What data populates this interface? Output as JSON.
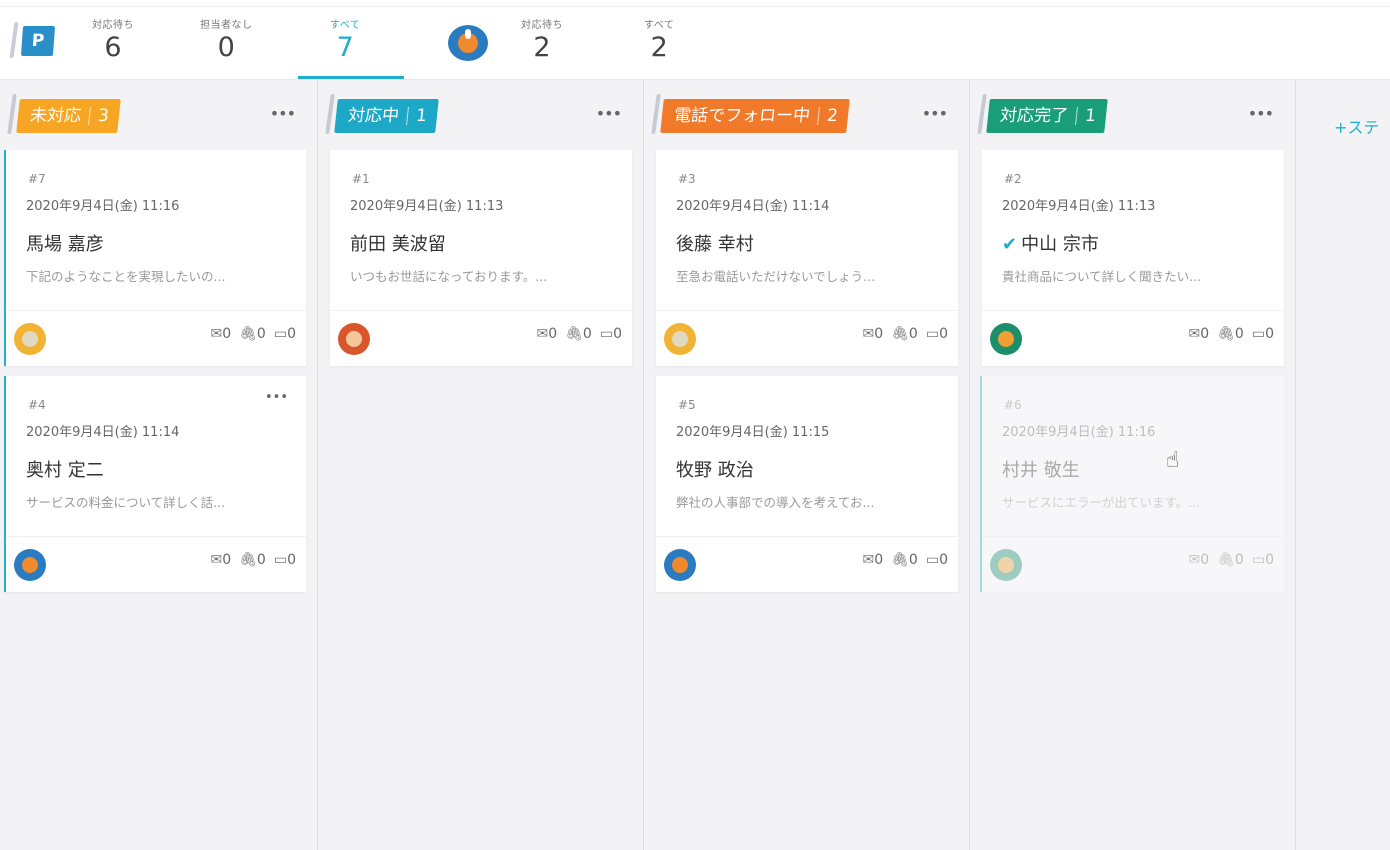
{
  "header": {
    "project_badge": "P",
    "stats": [
      {
        "label": "対応待ち",
        "value": "6"
      },
      {
        "label": "担当者なし",
        "value": "0"
      },
      {
        "label": "すべて",
        "value": "7"
      }
    ],
    "user_stats": [
      {
        "label": "対応待ち",
        "value": "2"
      },
      {
        "label": "すべて",
        "value": "2"
      }
    ]
  },
  "columns": [
    {
      "title": "未対応",
      "count": "3",
      "color": "#f6a623",
      "cards": [
        {
          "num": "#7",
          "date": "2020年9月4日(金) 11:16",
          "name": "馬場 嘉彦",
          "snippet": "下記のようなことを実現したいの...",
          "mail": "0",
          "clip": "0",
          "comment": "0",
          "avatar": "yellow"
        },
        {
          "num": "#4",
          "date": "2020年9月4日(金) 11:14",
          "name": "奥村 定二",
          "snippet": "サービスの料金について詳しく話...",
          "mail": "0",
          "clip": "0",
          "comment": "0",
          "avatar": "blue"
        }
      ]
    },
    {
      "title": "対応中",
      "count": "1",
      "color": "#1ea8c7",
      "cards": [
        {
          "num": "#1",
          "date": "2020年9月4日(金) 11:13",
          "name": "前田 美波留",
          "snippet": "いつもお世話になっております。...",
          "mail": "0",
          "clip": "0",
          "comment": "0",
          "avatar": "red"
        }
      ]
    },
    {
      "title": "電話でフォロー中",
      "count": "2",
      "color": "#f07a2a",
      "cards": [
        {
          "num": "#3",
          "date": "2020年9月4日(金) 11:14",
          "name": "後藤 幸村",
          "snippet": "至急お電話いただけないでしょう...",
          "mail": "0",
          "clip": "0",
          "comment": "0",
          "avatar": "yellow"
        },
        {
          "num": "#5",
          "date": "2020年9月4日(金) 11:15",
          "name": "牧野 政治",
          "snippet": "弊社の人事部での導入を考えてお...",
          "mail": "0",
          "clip": "0",
          "comment": "0",
          "avatar": "blue"
        }
      ]
    },
    {
      "title": "対応完了",
      "count": "1",
      "color": "#1a9e7a",
      "cards": [
        {
          "num": "#2",
          "date": "2020年9月4日(金) 11:13",
          "name": "中山 宗市",
          "snippet": "貴社商品について詳しく聞きたい...",
          "mail": "0",
          "clip": "0",
          "comment": "0",
          "avatar": "green"
        },
        {
          "num": "#6",
          "date": "2020年9月4日(金) 11:16",
          "name": "村井 敬生",
          "snippet": "サービスにエラーが出ています。...",
          "mail": "0",
          "clip": "0",
          "comment": "0",
          "avatar": "green"
        }
      ]
    }
  ],
  "add_status_label": "+ステ"
}
